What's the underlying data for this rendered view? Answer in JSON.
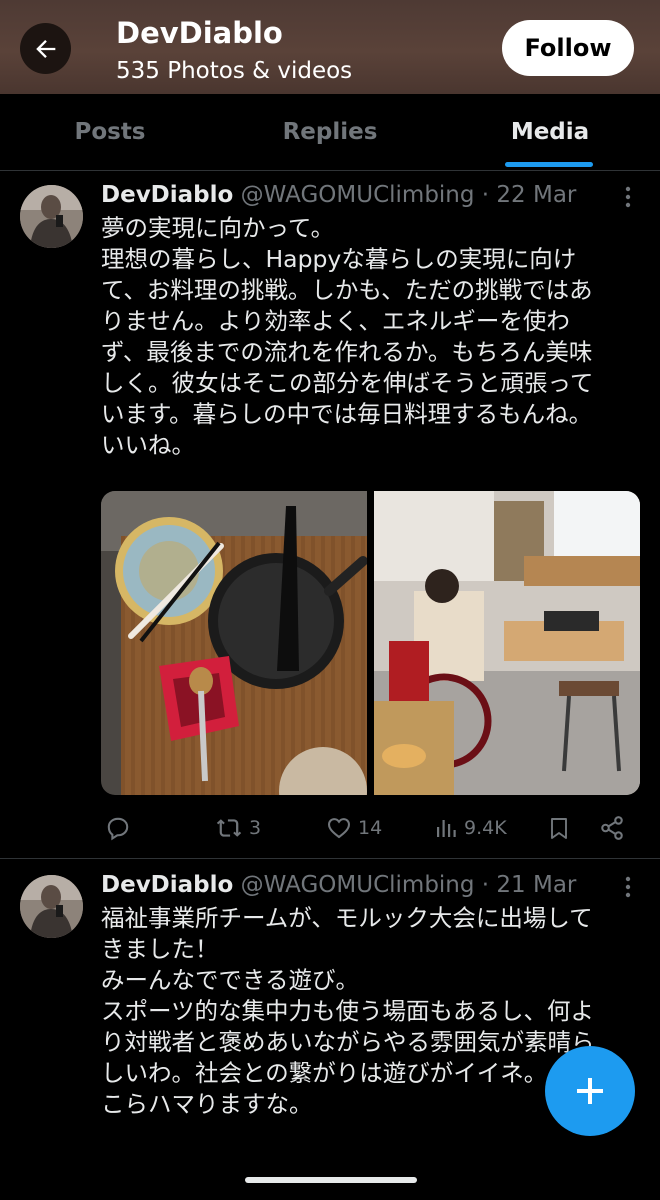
{
  "header": {
    "name": "DevDiablo",
    "subtitle": "535 Photos & videos",
    "follow_label": "Follow"
  },
  "tabs": [
    {
      "label": "Posts",
      "active": false
    },
    {
      "label": "Replies",
      "active": false
    },
    {
      "label": "Media",
      "active": true
    }
  ],
  "posts": [
    {
      "author_name": "DevDiablo",
      "author_meta": "@WAGOMUClimbing · 22 Mar",
      "text": "夢の実現に向かって。\n理想の暮らし、Happyな暮らしの実現に向け\nて、お料理の挑戦。しかも、ただの挑戦ではあ\nりません。より効率よく、エネルギーを使わ\nず、最後までの流れを作れるか。もちろん美味\nしく。彼女はそこの部分を伸ばそうと頑張って\nいます。暮らしの中では毎日料理するもんね。\nいいね。",
      "media": [
        {
          "icon": "cooking-photo"
        },
        {
          "icon": "wheelchair-cafe-photo"
        }
      ],
      "actions": {
        "replies": "",
        "reposts": "3",
        "likes": "14",
        "views": "9.4K"
      }
    },
    {
      "author_name": "DevDiablo",
      "author_meta": "@WAGOMUClimbing · 21 Mar",
      "text": "福祉事業所チームが、モルック大会に出場して\nきました！\nみーんなでできる遊び。\nスポーツ的な集中力も使う場面もあるし、何よ\nり対戦者と褒めあいながらやる雰囲気が素晴ら\nしいわ。社会との繋がりは遊びがイイネ。\nこらハマりますな。"
    }
  ],
  "colors": {
    "accent": "#1d9bf0",
    "background": "#000000",
    "muted": "#71767b",
    "header_bg": "#523d35"
  }
}
